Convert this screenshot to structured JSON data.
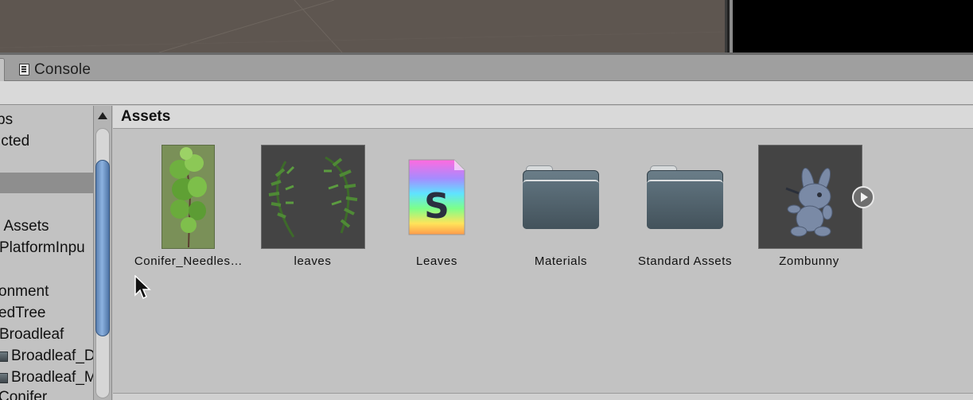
{
  "tabs": {
    "console_label": "Console",
    "console_icon": "console-icon"
  },
  "tree": {
    "items": [
      {
        "label": "bs"
      },
      {
        "label": "icted"
      },
      {
        "label": ""
      },
      {
        "label": "I Assets"
      },
      {
        "label": "PlatformInpu"
      },
      {
        "label": "onment"
      },
      {
        "label": "edTree"
      },
      {
        "label": "Broadleaf"
      },
      {
        "label": "Broadleaf_D"
      },
      {
        "label": "Broadleaf_M"
      },
      {
        "label": "Conifer"
      }
    ]
  },
  "assets": {
    "title": "Assets",
    "items": [
      {
        "label": "Conifer_Needles…",
        "icon": "conifer-texture-thumbnail"
      },
      {
        "label": "leaves",
        "icon": "leaves-texture-thumbnail"
      },
      {
        "label": "Leaves",
        "icon": "shader-file-icon"
      },
      {
        "label": "Materials",
        "icon": "folder-icon"
      },
      {
        "label": "Standard Assets",
        "icon": "folder-icon"
      },
      {
        "label": "Zombunny",
        "icon": "model-thumbnail"
      }
    ]
  },
  "colors": {
    "scroll_thumb": "#6f95c8",
    "folder": "#5a6c77"
  }
}
